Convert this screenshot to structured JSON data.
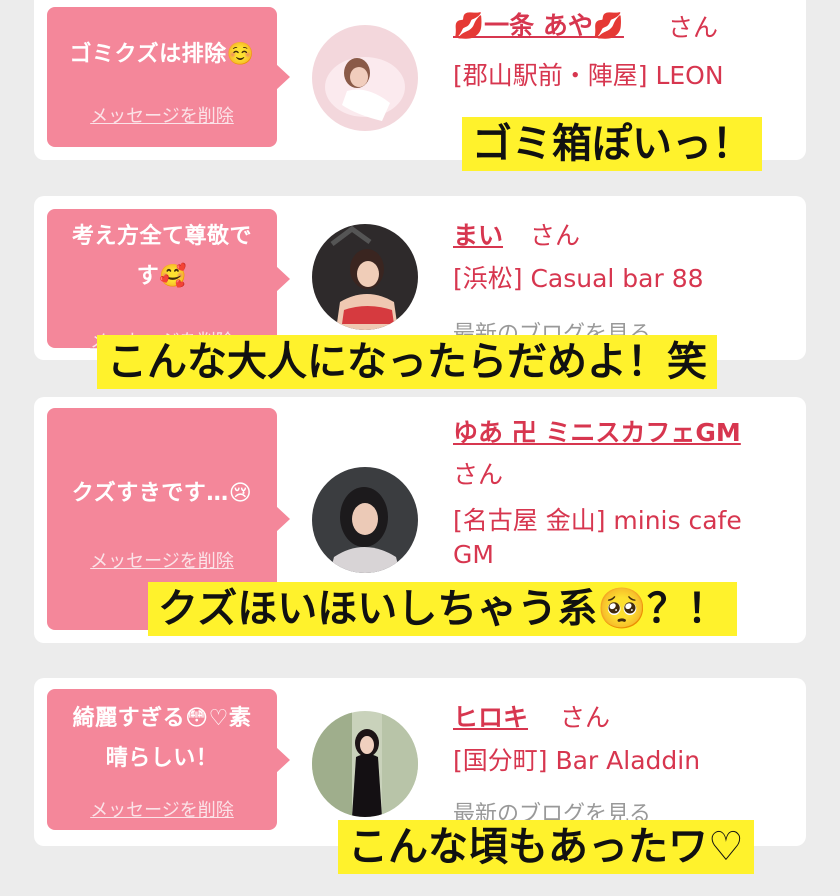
{
  "colors": {
    "bubble": "#f4879a",
    "link": "#d7364f",
    "caption_bg": "#fff22c",
    "card_bg": "#ffffff",
    "page_bg": "#ececec"
  },
  "entries": [
    {
      "message_lines": [
        "ゴミクズは排除☺️"
      ],
      "delete_label": "メッセージを削除",
      "name": "💋一条 あや💋",
      "honorific": "さん",
      "shop": "[郡山駅前・陣屋] LEON",
      "blog_link": ""
    },
    {
      "message_lines": [
        "考え方全て尊敬で",
        "す🥰"
      ],
      "delete_label": "メッセージを削除",
      "name": "まい",
      "honorific": "さん",
      "shop": "[浜松] Casual bar 88",
      "blog_link": "最新のブログを見る"
    },
    {
      "message_lines": [
        "クズすきです…😢"
      ],
      "delete_label": "メッセージを削除",
      "name": "ゆあ 卍 ミニスカフェGM",
      "honorific": "さん",
      "shop_lines": [
        "[名古屋 金山] minis cafe",
        "GM"
      ],
      "blog_link": ""
    },
    {
      "message_lines": [
        "綺麗すぎる😳♡素",
        "晴らしい！"
      ],
      "delete_label": "メッセージを削除",
      "name": "ヒロキ",
      "honorific": "さん",
      "shop": "[国分町] Bar Aladdin",
      "blog_link": "最新のブログを見る"
    }
  ],
  "captions": [
    "ゴミ箱ぽいっ！",
    "こんな大人になったらだめよ！笑",
    "クズほいほいしちゃう系🥺？！",
    "こんな頃もあったワ♡"
  ]
}
